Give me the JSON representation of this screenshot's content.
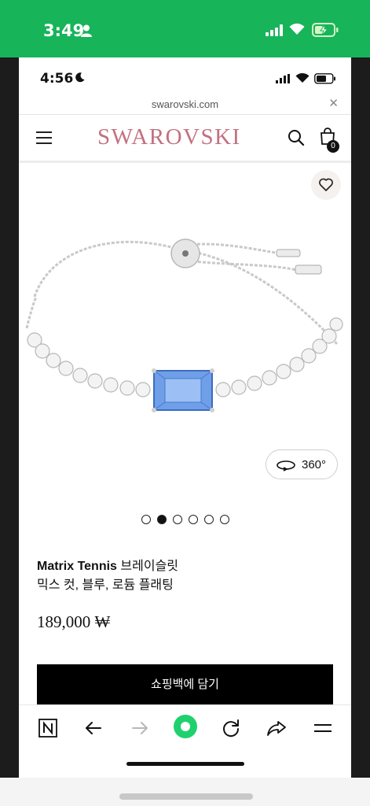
{
  "outer_status": {
    "time": "3:49"
  },
  "inner_status": {
    "time": "4:56"
  },
  "browser": {
    "url": "swarovski.com"
  },
  "header": {
    "brand": "SWAROVSKI",
    "cart_count": "0"
  },
  "product": {
    "view360_label": "360°",
    "dots": {
      "count": 6,
      "active_index": 1
    },
    "title_strong": "Matrix Tennis",
    "title_rest": "브레이슬릿",
    "subtitle": "믹스 컷, 블루, 로듐 플래팅",
    "price": "189,000 ₩",
    "add_to_bag_label": "쇼핑백에 담기"
  },
  "colors": {
    "outer_status_bg": "#17b45a",
    "brand": "#c4707e",
    "toolbar_center": "#1fd16e",
    "gem": "#6f9fe6"
  },
  "icons": {
    "outer": [
      "person-icon",
      "signal-icon",
      "wifi-icon",
      "battery-charging-icon"
    ],
    "inner": [
      "moon-icon",
      "signal-icon",
      "wifi-icon",
      "battery-icon"
    ],
    "toolbar": [
      "naver-home-icon",
      "back-arrow-icon",
      "forward-arrow-icon",
      "green-dot-icon",
      "reload-icon",
      "share-icon",
      "menu-icon"
    ]
  }
}
